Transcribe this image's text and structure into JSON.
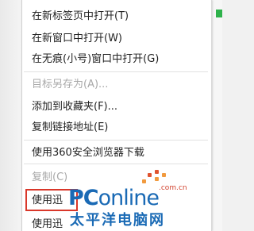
{
  "menu": {
    "items": [
      {
        "label": "在新标签页中打开(T)",
        "disabled": false
      },
      {
        "label": "在新窗口中打开(W)",
        "disabled": false
      },
      {
        "label": "在无痕(小号)窗口中打开(G)",
        "disabled": false
      },
      {
        "label": "目标另存为(A)...",
        "disabled": true
      },
      {
        "label": "添加到收藏夹(F)...",
        "disabled": false
      },
      {
        "label": "复制链接地址(E)",
        "disabled": false
      },
      {
        "label": "使用360安全浏览器下载",
        "disabled": false
      },
      {
        "label": "复制(C)",
        "disabled": true
      },
      {
        "label": "使用迅",
        "disabled": false
      },
      {
        "label": "使用迅",
        "disabled": false
      }
    ]
  },
  "watermark": {
    "brand_pc": "PC",
    "brand_online": "online",
    "domain": ".com.cn",
    "tagline": "太平洋电脑网"
  },
  "colors": {
    "highlight": "#d9372a",
    "brand_blue": "#1a6ab5",
    "accent_orange": "#e0532f"
  }
}
